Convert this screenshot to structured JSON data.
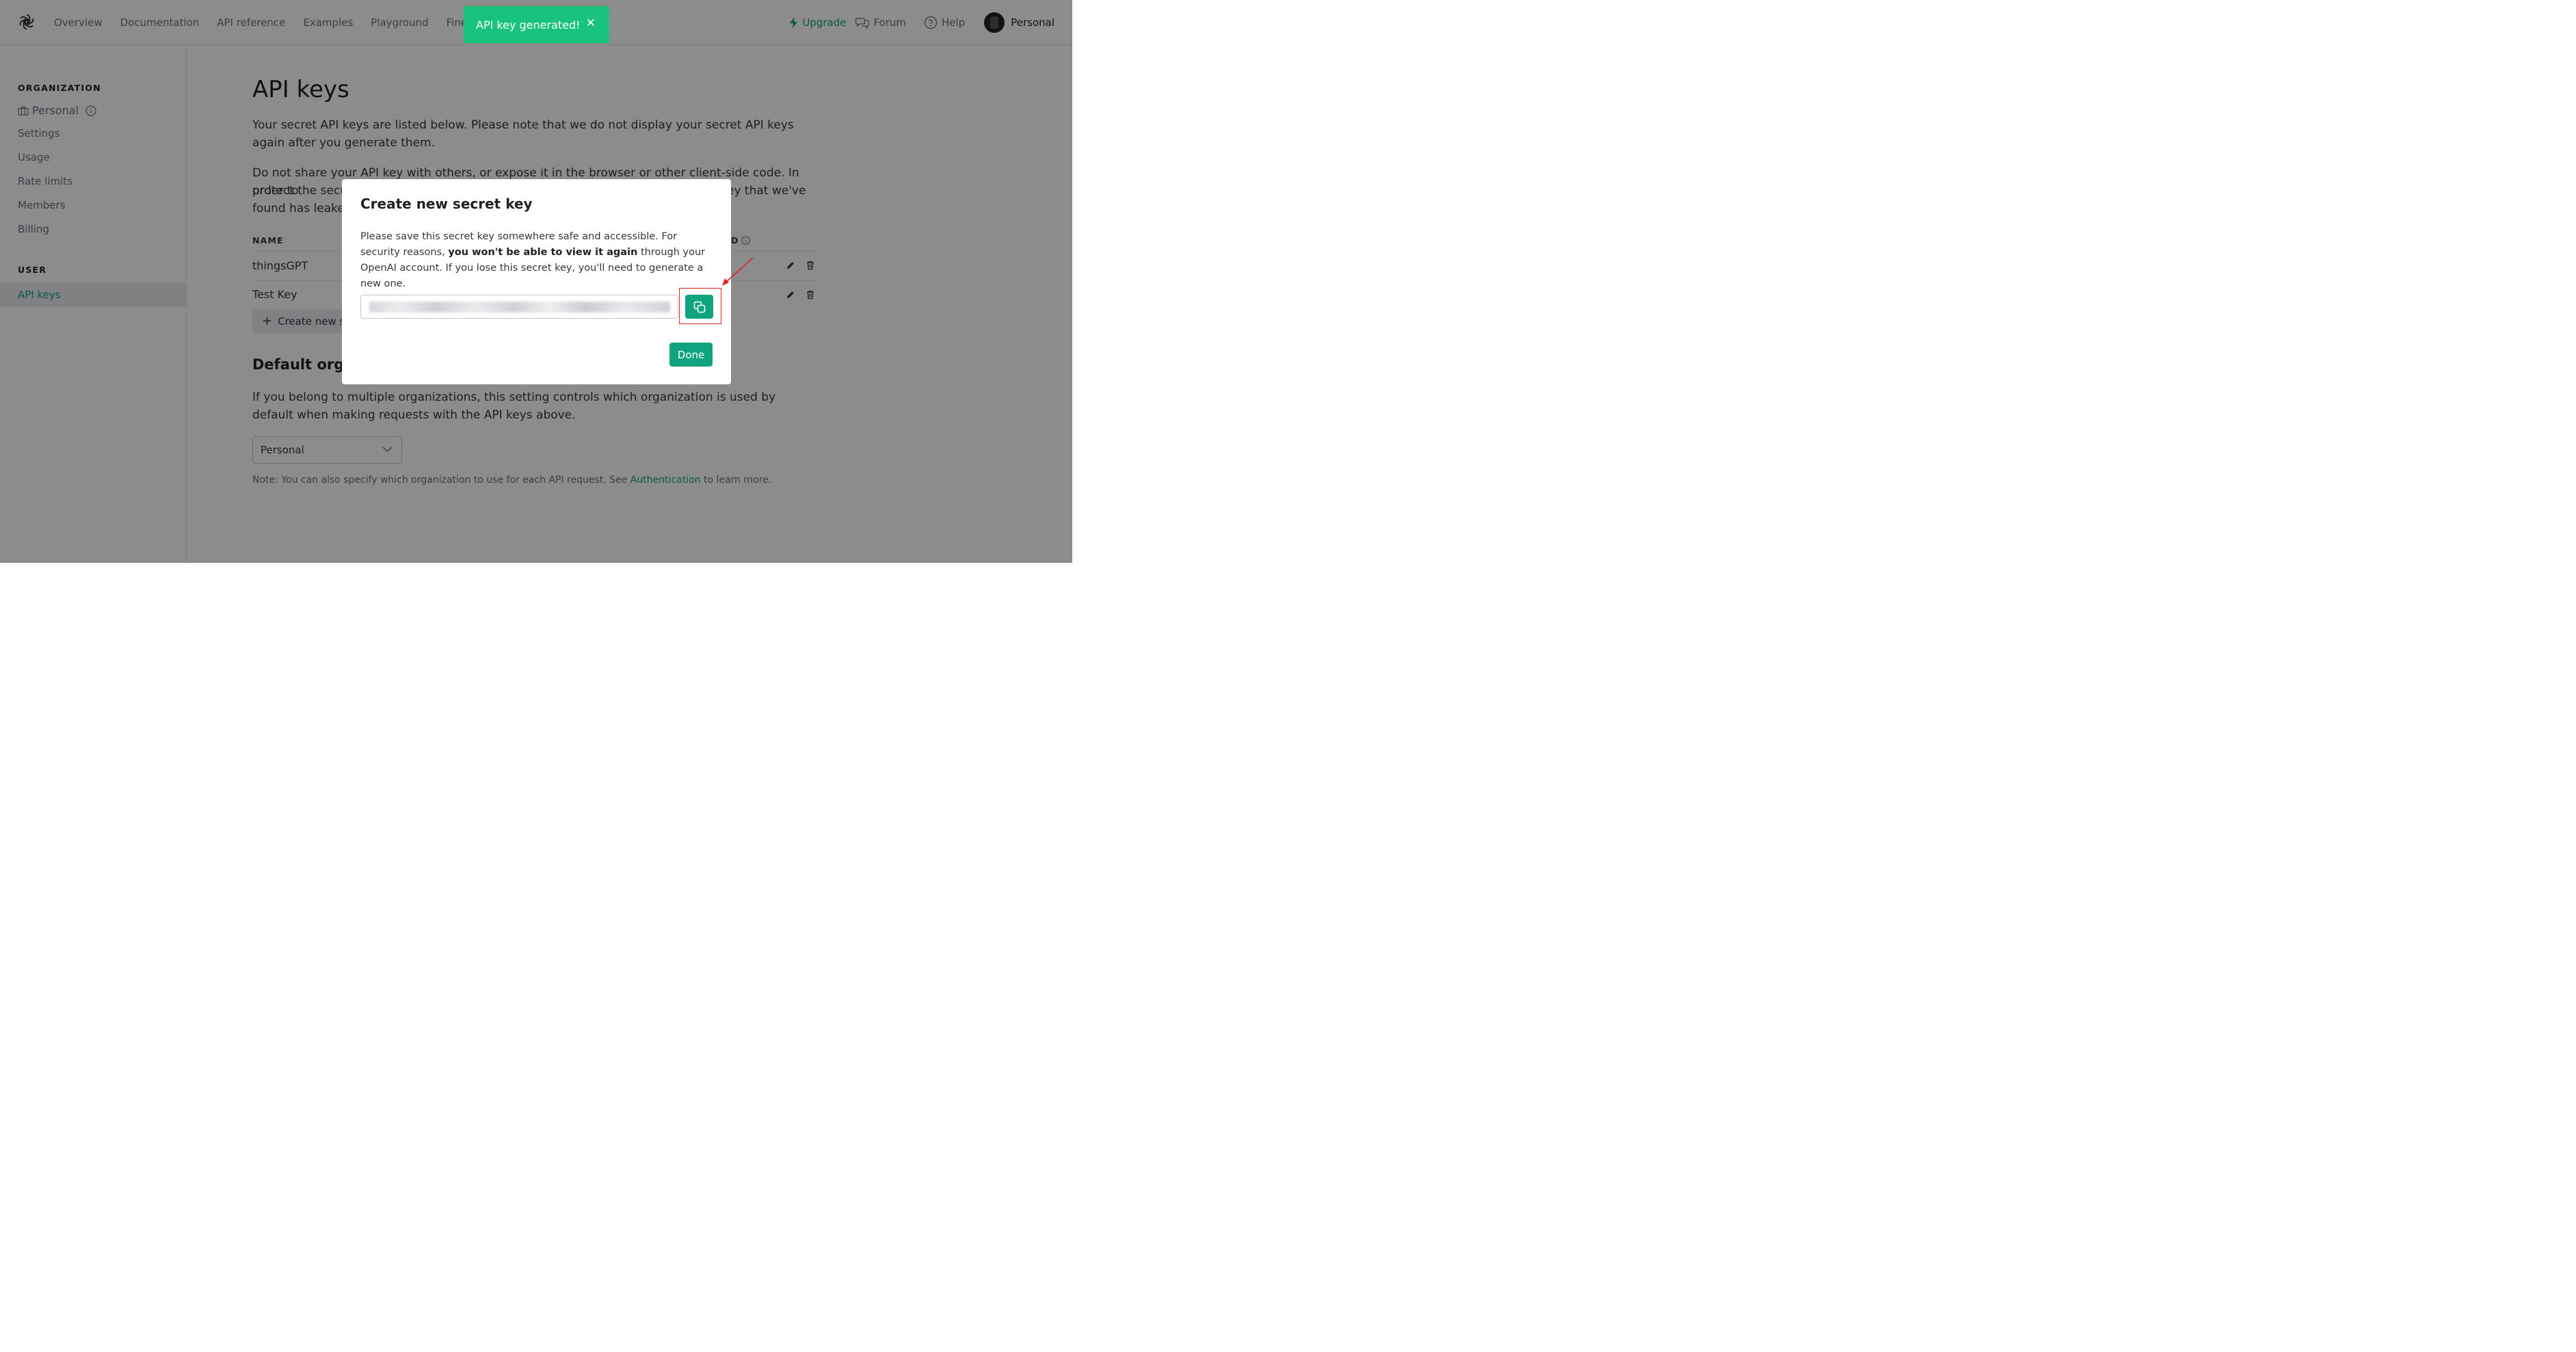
{
  "nav": {
    "links": [
      "Overview",
      "Documentation",
      "API reference",
      "Examples",
      "Playground",
      "Fine-t"
    ],
    "upgrade": "Upgrade",
    "forum": "Forum",
    "help": "Help",
    "account": "Personal"
  },
  "sidebar": {
    "org_heading": "ORGANIZATION",
    "org_name": "Personal",
    "items": [
      "Settings",
      "Usage",
      "Rate limits",
      "Members",
      "Billing"
    ],
    "user_heading": "USER",
    "active_item": "API keys"
  },
  "main": {
    "title": "API keys",
    "para1": "Your secret API keys are listed below. Please note that we do not display your secret API keys again after you generate them.",
    "para2_line1": "Do not share your API key with others, or expose it in the browser or other client-side code. In order to",
    "para2_line2_left": "protect the secu",
    "para2_line2_right": "ey that we've",
    "para2_line3": "found has leake",
    "table_header_name": "NAME",
    "table_header_right": "D",
    "keys": [
      {
        "name": "thingsGPT"
      },
      {
        "name": "Test Key"
      }
    ],
    "create_button": "Create new se",
    "default_org_title": "Default organ",
    "default_org_desc": "If you belong to multiple organizations, this setting controls which organization is used by default when making requests with the API keys above.",
    "select_value": "Personal",
    "note_prefix": "Note: You can also specify which organization to use for each API request. See ",
    "note_link": "Authentication",
    "note_suffix": " to learn more."
  },
  "modal": {
    "title": "Create new secret key",
    "body_part1": "Please save this secret key somewhere safe and accessible. For security reasons, ",
    "body_bold": "you won't be able to view it again",
    "body_part2": " through your OpenAI account. If you lose this secret key, you'll need to generate a new one.",
    "done_label": "Done"
  },
  "toast": {
    "message": "API key generated!",
    "close": "✕"
  },
  "colors": {
    "accent": "#10a37f",
    "toast": "#19c37d",
    "highlight": "#e02424"
  }
}
